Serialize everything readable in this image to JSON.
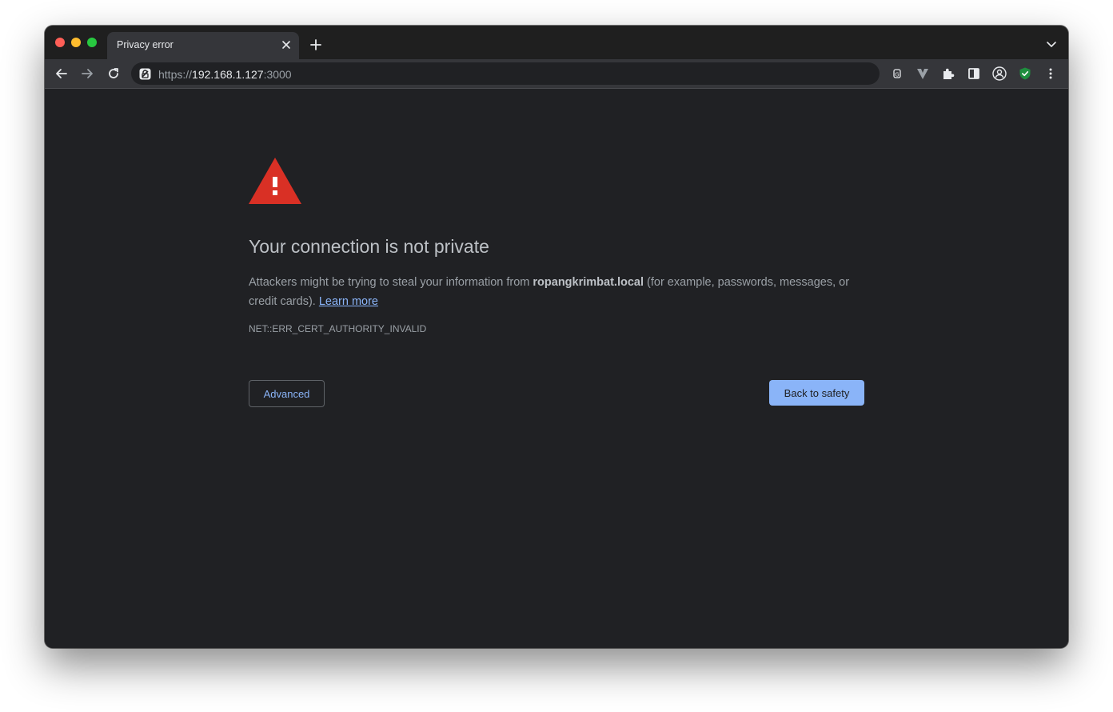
{
  "browser": {
    "tab": {
      "title": "Privacy error",
      "close_icon": "close-icon"
    },
    "new_tab_icon": "plus-icon",
    "tab_dropdown_icon": "chevron-down-icon",
    "url": {
      "scheme": "https://",
      "host": "192.168.1.127",
      "port": ":3000"
    },
    "toolbar_icons": [
      "back-arrow-icon",
      "forward-arrow-icon",
      "reload-icon",
      "not-secure-icon",
      "translate-icon",
      "vivaldi-v-icon",
      "puzzle-extensions-icon",
      "side-panel-icon",
      "profile-icon",
      "shield-check-icon",
      "kebab-menu-icon"
    ],
    "colors": {
      "frame": "#1f1f1f",
      "toolbar": "#35363a",
      "page_background": "#202124",
      "warning_red": "#d93025",
      "link_blue": "#8ab4f8",
      "shield_green": "#1e8e3e"
    }
  },
  "page": {
    "heading": "Your connection is not private",
    "message_prefix": "Attackers might be trying to steal your information from ",
    "message_host": "ropangkrimbat.local",
    "message_suffix": " (for example, passwords, messages, or credit cards). ",
    "learn_more": "Learn more",
    "error_code": "NET::ERR_CERT_AUTHORITY_INVALID",
    "advanced_button": "Advanced",
    "back_button": "Back to safety"
  }
}
